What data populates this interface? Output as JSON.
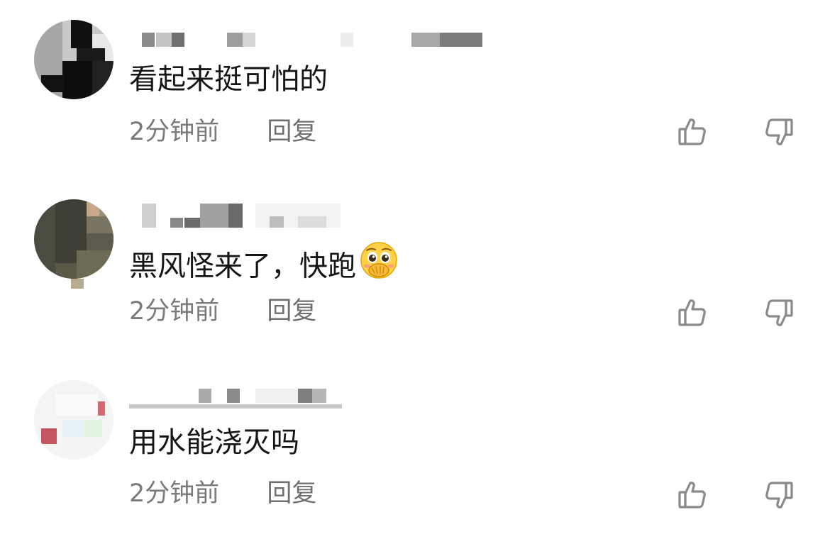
{
  "comments": [
    {
      "text": "看起来挺可怕的",
      "time": "2分钟前",
      "reply_label": "回复",
      "like_icon": "thumbs-up-icon",
      "dislike_icon": "thumbs-down-icon"
    },
    {
      "text": "黑风怪来了，快跑",
      "emoji": "pleading-face-hands-over-mouth-emoji",
      "time": "2分钟前",
      "reply_label": "回复",
      "like_icon": "thumbs-up-icon",
      "dislike_icon": "thumbs-down-icon"
    },
    {
      "text": "用水能浇灭吗",
      "time": "2分钟前",
      "reply_label": "回复",
      "like_icon": "thumbs-up-icon",
      "dislike_icon": "thumbs-down-icon"
    }
  ],
  "colors": {
    "text_primary": "#161616",
    "text_secondary": "#7a7a7a",
    "icon": "#8a8a8a"
  }
}
